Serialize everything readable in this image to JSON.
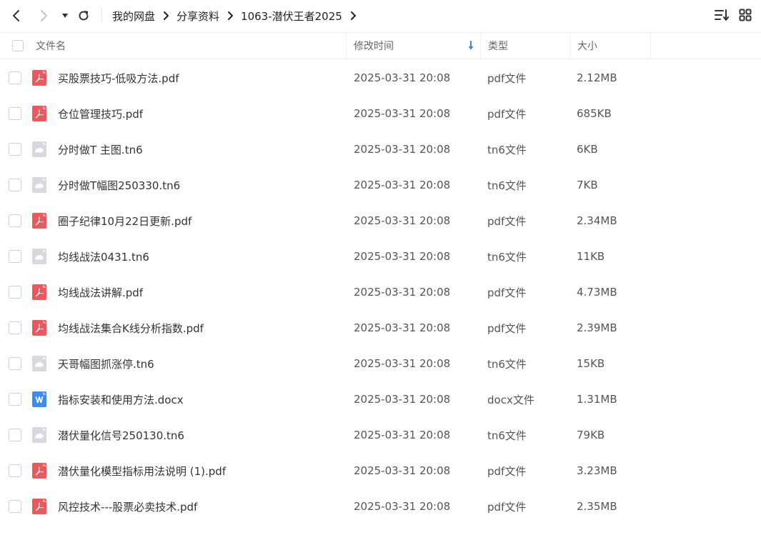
{
  "breadcrumb": [
    "我的网盘",
    "分享资料",
    "1063-潜伏王者2025"
  ],
  "columns": {
    "name": "文件名",
    "modified": "修改时间",
    "type": "类型",
    "size": "大小"
  },
  "files": [
    {
      "icon": "pdf-file-icon",
      "name": "买股票技巧-低吸方法.pdf",
      "modified": "2025-03-31 20:08",
      "type": "pdf文件",
      "size": "2.12MB"
    },
    {
      "icon": "pdf-file-icon",
      "name": "仓位管理技巧.pdf",
      "modified": "2025-03-31 20:08",
      "type": "pdf文件",
      "size": "685KB"
    },
    {
      "icon": "cloud-file-icon",
      "name": "分时做T 主图.tn6",
      "modified": "2025-03-31 20:08",
      "type": "tn6文件",
      "size": "6KB"
    },
    {
      "icon": "cloud-file-icon",
      "name": "分时做T幅图250330.tn6",
      "modified": "2025-03-31 20:08",
      "type": "tn6文件",
      "size": "7KB"
    },
    {
      "icon": "pdf-file-icon",
      "name": "圈子纪律10月22日更新.pdf",
      "modified": "2025-03-31 20:08",
      "type": "pdf文件",
      "size": "2.34MB"
    },
    {
      "icon": "cloud-file-icon",
      "name": "均线战法0431.tn6",
      "modified": "2025-03-31 20:08",
      "type": "tn6文件",
      "size": "11KB"
    },
    {
      "icon": "pdf-file-icon",
      "name": "均线战法讲解.pdf",
      "modified": "2025-03-31 20:08",
      "type": "pdf文件",
      "size": "4.73MB"
    },
    {
      "icon": "pdf-file-icon",
      "name": "均线战法集合K线分析指数.pdf",
      "modified": "2025-03-31 20:08",
      "type": "pdf文件",
      "size": "2.39MB"
    },
    {
      "icon": "cloud-file-icon",
      "name": "天哥幅图抓涨停.tn6",
      "modified": "2025-03-31 20:08",
      "type": "tn6文件",
      "size": "15KB"
    },
    {
      "icon": "word-file-icon",
      "name": "指标安装和使用方法.docx",
      "modified": "2025-03-31 20:08",
      "type": "docx文件",
      "size": "1.31MB"
    },
    {
      "icon": "cloud-file-icon",
      "name": "潜伏量化信号250130.tn6",
      "modified": "2025-03-31 20:08",
      "type": "tn6文件",
      "size": "79KB"
    },
    {
      "icon": "pdf-file-icon",
      "name": "潜伏量化模型指标用法说明 (1).pdf",
      "modified": "2025-03-31 20:08",
      "type": "pdf文件",
      "size": "3.23MB"
    },
    {
      "icon": "pdf-file-icon",
      "name": "风控技术---股票必卖技术.pdf",
      "modified": "2025-03-31 20:08",
      "type": "pdf文件",
      "size": "2.35MB"
    }
  ],
  "colors": {
    "pdf": "#f1565a",
    "word": "#3a8bf5",
    "cloud": "#d7d9de",
    "sort_arrow": "#2b8ae8"
  }
}
